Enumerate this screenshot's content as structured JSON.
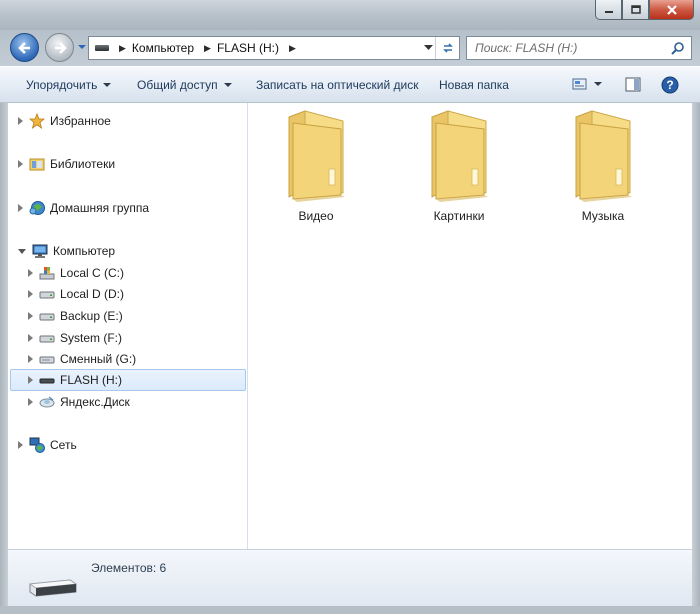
{
  "window": {
    "controls": {
      "minimize": "minimize",
      "maximize": "maximize",
      "close": "close"
    }
  },
  "navigation": {
    "breadcrumb": [
      "Компьютер",
      "FLASH (H:)"
    ],
    "search_placeholder": "Поиск: FLASH (H:)"
  },
  "toolbar": {
    "organize_label": "Упорядочить",
    "share_label": "Общий доступ",
    "burn_label": "Записать на оптический диск",
    "new_folder_label": "Новая папка"
  },
  "sidebar": {
    "favorites": "Избранное",
    "libraries": "Библиотеки",
    "homegroup": "Домашняя группа",
    "computer": "Компьютер",
    "drives": [
      "Local C (C:)",
      "Local D (D:)",
      "Backup (E:)",
      "System (F:)",
      "Сменный (G:)",
      "FLASH (H:)",
      "Яндекс.Диск"
    ],
    "selected": "FLASH (H:)",
    "network": "Сеть"
  },
  "content": {
    "folders": [
      "Видео",
      "Картинки",
      "Музыка"
    ]
  },
  "status": {
    "item_count": "Элементов: 6"
  },
  "colors": {
    "folder": "#f5d97a",
    "selection": "#dbeafb",
    "toolbar_text": "#1e395b"
  }
}
